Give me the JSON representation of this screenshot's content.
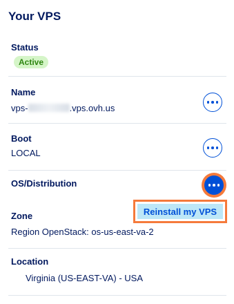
{
  "panel": {
    "title": "Your VPS"
  },
  "status": {
    "label": "Status",
    "badge": "Active"
  },
  "name": {
    "label": "Name",
    "value_prefix": "vps-",
    "value_suffix": ".vps.ovh.us",
    "action_icon": "ellipsis-icon"
  },
  "boot": {
    "label": "Boot",
    "value": "LOCAL",
    "action_icon": "ellipsis-icon"
  },
  "os": {
    "label": "OS/Distribution",
    "action_icon": "ellipsis-icon",
    "menu": {
      "items": [
        {
          "label": "Reinstall my VPS"
        }
      ]
    }
  },
  "zone": {
    "label": "Zone",
    "value": "Region OpenStack: os-us-east-va-2"
  },
  "location": {
    "label": "Location",
    "value": "Virginia (US-EAST-VA) - USA"
  },
  "colors": {
    "text": "#00185e",
    "accent": "#0050d7",
    "active_badge_bg": "#d5f5c8",
    "active_badge_text": "#2f8612",
    "highlight": "#f57a3b",
    "menu_item_bg": "#bde7f7",
    "divider": "#dfe5eb"
  }
}
